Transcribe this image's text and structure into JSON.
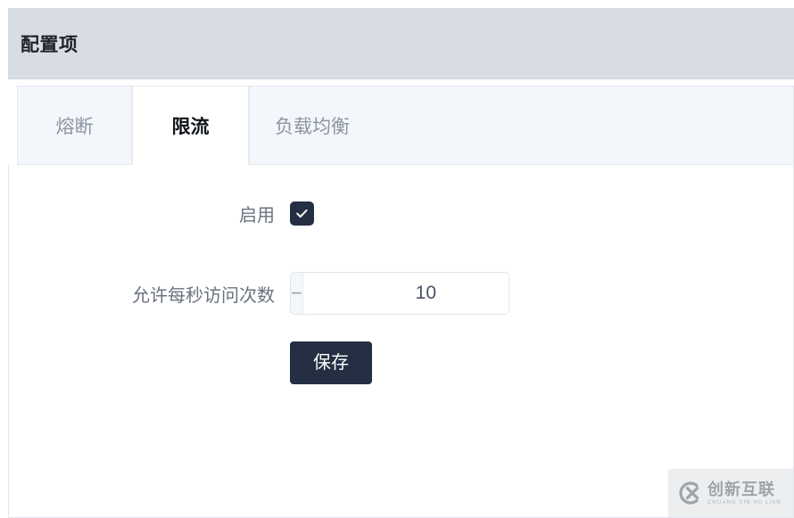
{
  "panel": {
    "title": "配置项"
  },
  "tabs": [
    {
      "label": "熔断",
      "active": false
    },
    {
      "label": "限流",
      "active": true
    },
    {
      "label": "负载均衡",
      "active": false
    }
  ],
  "form": {
    "enable": {
      "label": "启用",
      "checked": true
    },
    "rate": {
      "label": "允许每秒访问次数",
      "value": "10",
      "placeholder": "",
      "minus_label": "−",
      "plus_label": "+"
    },
    "save_label": "保存"
  },
  "watermark": {
    "cn": "创新互联",
    "en": "CHUANG XIN HU LIAN",
    "logo_letter": "X"
  },
  "colors": {
    "header_bg": "#d8dce3",
    "tab_inactive_bg": "#f3f6fa",
    "tab_active_bg": "#ffffff",
    "accent_dark": "#242f44",
    "label_text": "#6a7280",
    "border": "#e3e8ef"
  }
}
